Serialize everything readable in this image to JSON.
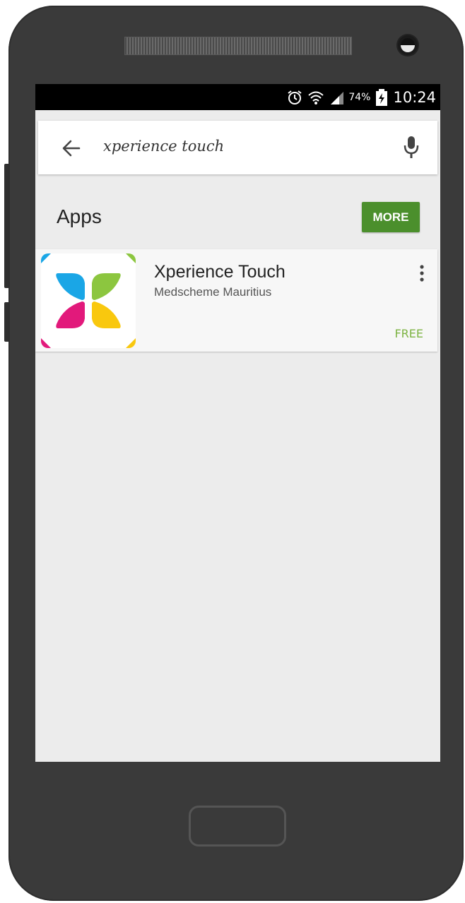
{
  "status_bar": {
    "battery_percent": "74%",
    "time": "10:24",
    "icons": [
      "alarm-icon",
      "wifi-icon",
      "signal-icon",
      "battery-charging-icon"
    ]
  },
  "search": {
    "query": "xperience touch",
    "back_icon": "arrow-left-icon",
    "mic_icon": "microphone-icon"
  },
  "section": {
    "title": "Apps",
    "more_label": "MORE"
  },
  "results": [
    {
      "name": "Xperience  Touch",
      "developer": "Medscheme Mauritius",
      "price": "FREE",
      "menu_icon": "more-vert-icon"
    }
  ],
  "colors": {
    "more_button": "#4b8f2c",
    "price_text": "#7cb342",
    "logo_blue": "#1aa6e6",
    "logo_green": "#8cc63f",
    "logo_magenta": "#e2197b",
    "logo_yellow": "#f9c80e"
  }
}
